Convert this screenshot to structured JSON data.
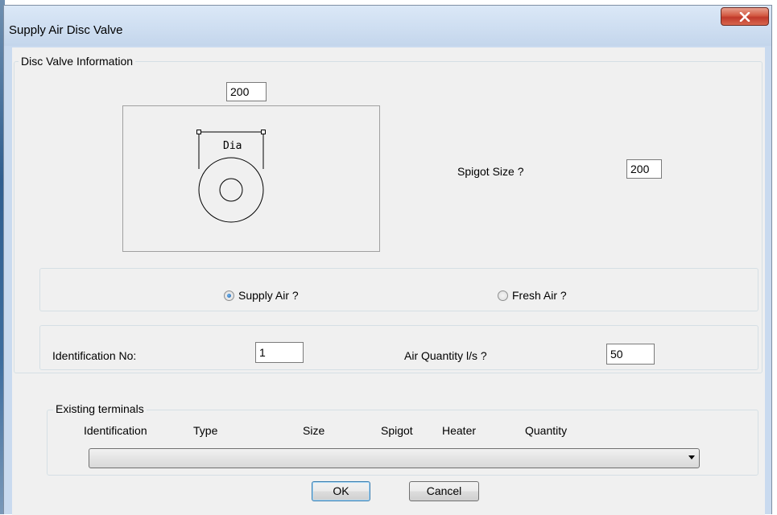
{
  "window": {
    "title": "Supply Air Disc Valve",
    "close_glyph": "x"
  },
  "disc_valve_info": {
    "group_label": "Disc Valve Information",
    "diameter_value": "200",
    "diagram_label": "Dia",
    "spigot_size_label": "Spigot Size ?",
    "spigot_size_value": "200"
  },
  "air_type": {
    "supply_air_label": "Supply Air ?",
    "supply_air_checked": true,
    "fresh_air_label": "Fresh Air ?",
    "fresh_air_checked": false
  },
  "identification": {
    "id_label": "Identification No:",
    "id_value": "1",
    "air_quantity_label": "Air Quantity l/s ?",
    "air_quantity_value": "50"
  },
  "existing_terminals": {
    "group_label": "Existing terminals",
    "columns": [
      "Identification",
      "Type",
      "Size",
      "Spigot",
      "Heater",
      "Quantity"
    ],
    "selected_value": ""
  },
  "buttons": {
    "ok": "OK",
    "cancel": "Cancel"
  },
  "colors": {
    "close_button": "#c0392b",
    "radio_selected": "#1d5ea8"
  },
  "icons": {
    "close": "close-icon",
    "dropdown": "chevron-down-icon",
    "radio": "radio-icon"
  }
}
